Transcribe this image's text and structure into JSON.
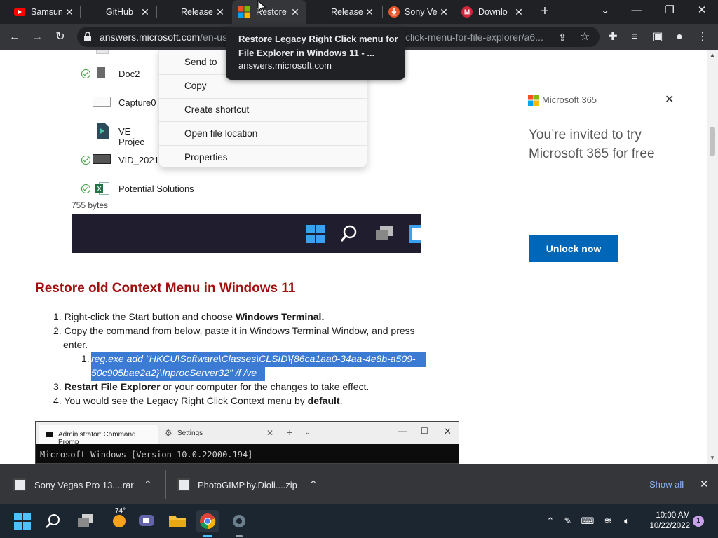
{
  "browser": {
    "tabs": [
      {
        "title": "Samsung",
        "icon": "youtube-icon"
      },
      {
        "title": "GitHub",
        "icon": "github-icon"
      },
      {
        "title": "Releases",
        "icon": "github-icon"
      },
      {
        "title": "Restore",
        "icon": "microsoft-icon",
        "active": true
      },
      {
        "title": "Releases",
        "icon": "github-icon"
      },
      {
        "title": "Sony Ve",
        "icon": "download-icon"
      },
      {
        "title": "Downlo",
        "icon": "gmail-icon"
      }
    ],
    "url_host": "answers.microsoft.com",
    "url_path": "/en-us",
    "url_tail": "click-menu-for-file-explorer/a6...",
    "tooltip": {
      "title": "Restore Legacy Right Click menu for File Explorer in Windows 11 - ...",
      "host": "answers.microsoft.com"
    }
  },
  "page": {
    "files": [
      {
        "name": "Doc2",
        "synced": true
      },
      {
        "name": "Capture0",
        "synced": false
      },
      {
        "name": "VE Projec",
        "synced": false
      },
      {
        "name": "VID_2021",
        "synced": true
      },
      {
        "name": "Potential Solutions",
        "synced": true
      }
    ],
    "file_size": "755 bytes",
    "context_menu": [
      "Send to",
      "Copy",
      "Create shortcut",
      "Open file location",
      "Properties"
    ],
    "heading": "Restore old Context Menu in Windows 11",
    "steps": {
      "s1_a": "Right-click the Start button and choose ",
      "s1_b": "Windows Terminal.",
      "s2_line1": "Copy the command from below, paste it in Windows Terminal Window, and press",
      "s2_line2": "enter.",
      "code_line1": "reg.exe add \"HKCU\\Software\\Classes\\CLSID\\{86ca1aa0-34aa-4e8b-a509-",
      "code_line2": "50c905bae2a2}\\InprocServer32\" /f /ve",
      "s3_a": "Restart File Explorer",
      "s3_b": " or your computer for the changes to take effect.",
      "s4_a": "You would see the Legacy Right Click Context menu by ",
      "s4_b": "default",
      "s4_c": "."
    },
    "cmd": {
      "tab1": "Administrator: Command Promp",
      "tab2": "Settings",
      "line": "Microsoft Windows [Version 10.0.22000.194]"
    },
    "ad": {
      "brand": "Microsoft 365",
      "text": "You’re invited to try Microsoft 365 for free",
      "button": "Unlock now"
    }
  },
  "downloads": {
    "items": [
      {
        "name": "Sony Vegas Pro 13....rar"
      },
      {
        "name": "PhotoGIMP.by.Dioli....zip"
      }
    ],
    "show_all": "Show all"
  },
  "taskbar": {
    "weather_temp": "74°",
    "time": "10:00 AM",
    "date": "10/22/2022",
    "notifications": "1"
  },
  "colors": {
    "heading": "#a10f0f",
    "accent": "#0067b8",
    "highlight": "#3b7bd4"
  }
}
